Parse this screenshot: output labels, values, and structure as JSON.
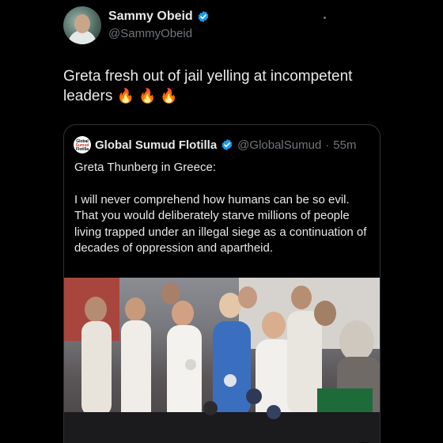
{
  "author": {
    "display_name": "Sammy Obeid",
    "handle": "@SammyObeid",
    "verified": true,
    "avatar_icon": "profile-photo"
  },
  "tweet": {
    "text": "Greta fresh out of jail yelling at incompetent leaders ",
    "emoji": "🔥 🔥 🔥"
  },
  "quoted": {
    "display_name": "Global Sumud Flotilla",
    "handle": "@GlobalSumud",
    "separator": "·",
    "time": "55m",
    "verified": true,
    "avatar_lines": [
      "Global",
      "Sumud",
      "Flotilla"
    ],
    "paragraphs": [
      "Greta Thunberg in Greece:",
      "I will never comprehend how humans can be so evil. That you would deliberately starve millions of people living trapped under an illegal siege as a continuation of decades of oppression and apartheid."
    ]
  },
  "media": {
    "type": "video",
    "mute_icon": "mute-speaker-icon"
  },
  "colors": {
    "background": "#000000",
    "text": "#e7e9ea",
    "secondary_text": "#71767b",
    "verified_blue": "#1d9bf0",
    "border": "#2f3336"
  }
}
